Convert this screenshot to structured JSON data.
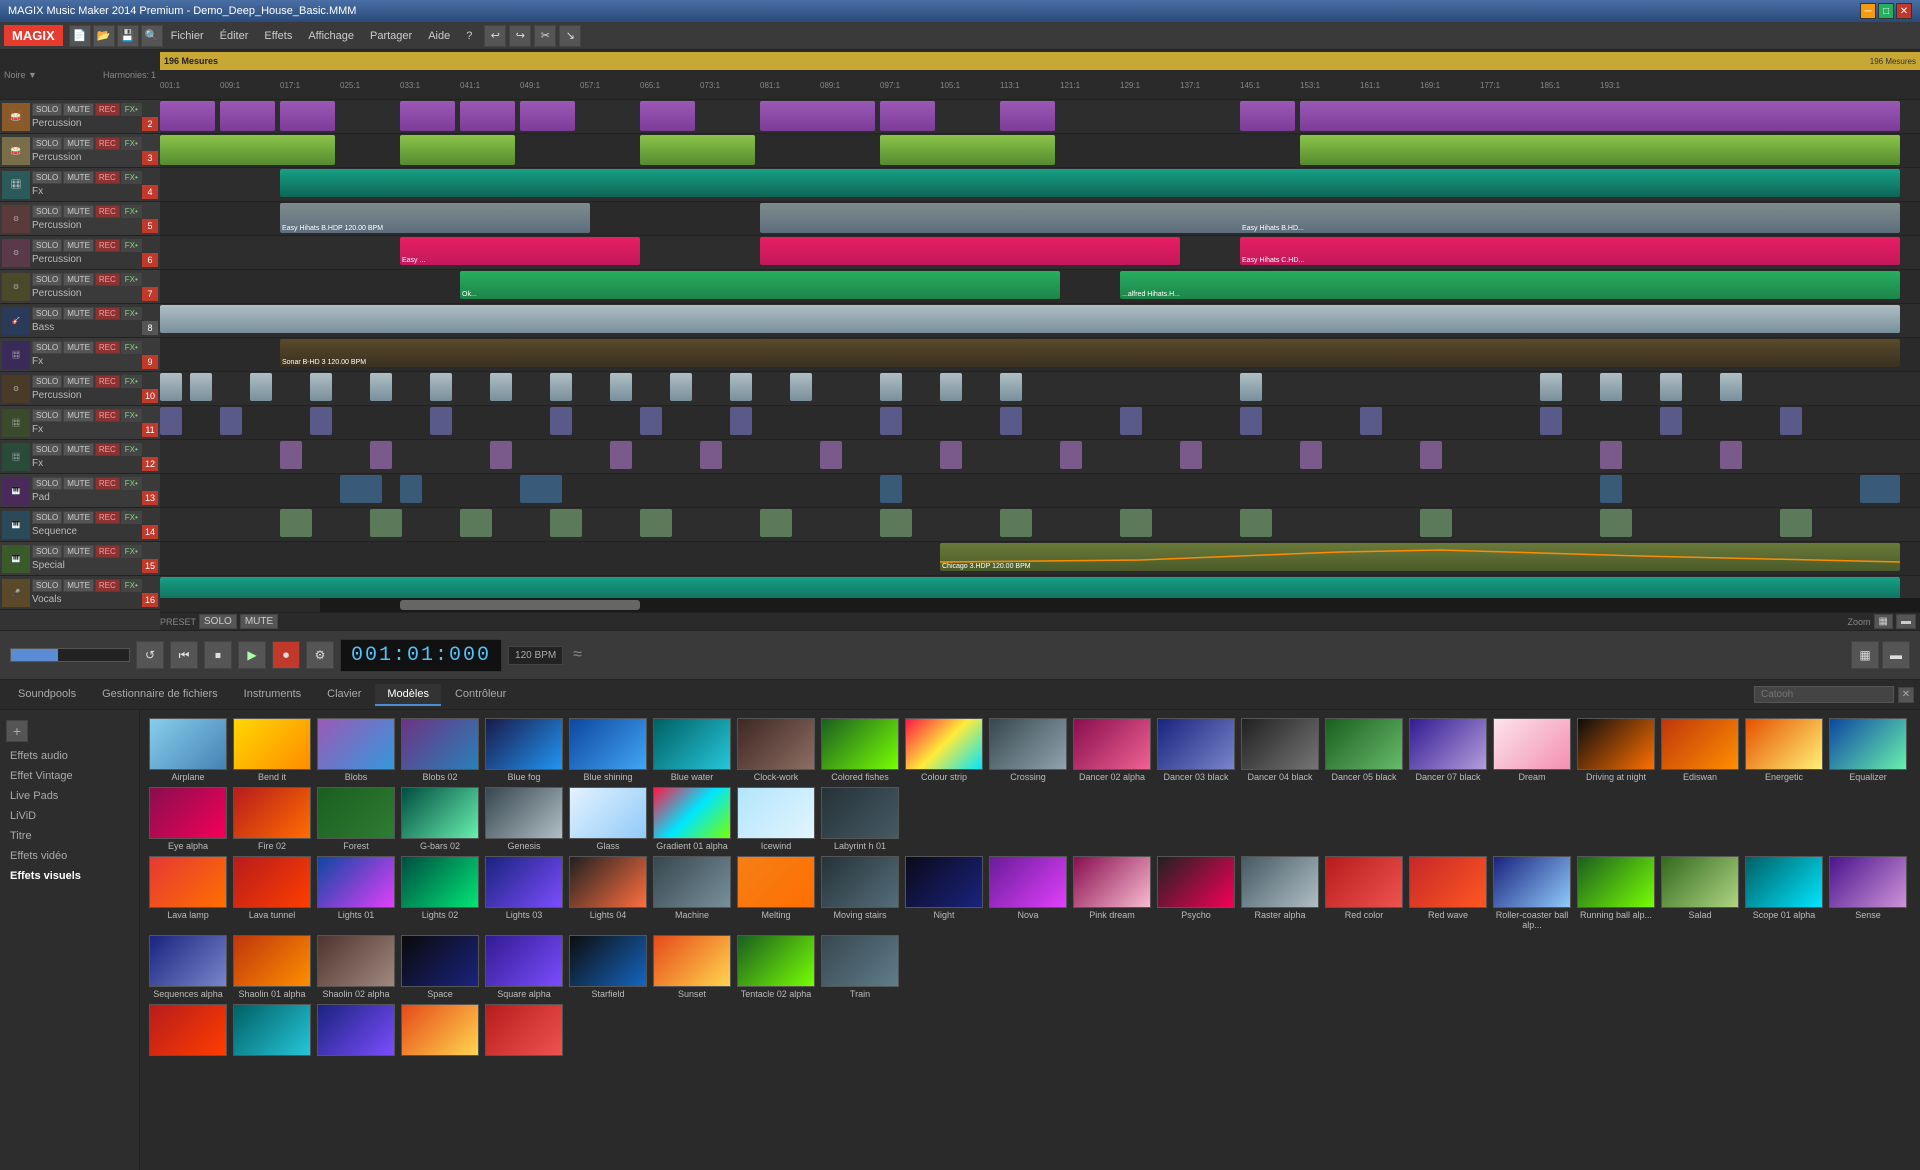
{
  "titlebar": {
    "title": "MAGIX Music Maker 2014 Premium - Demo_Deep_House_Basic.MMM",
    "min": "─",
    "max": "□",
    "close": "✕"
  },
  "menubar": {
    "items": [
      "Fichier",
      "Éditer",
      "Effets",
      "Affichage",
      "Partager",
      "Aide",
      "?"
    ]
  },
  "transport": {
    "time": "001:01:000",
    "bpm": "120 BPM",
    "loop_btn": "↺",
    "rewind_btn": "⏮",
    "stop_btn": "⏹",
    "play_btn": "▶",
    "record_btn": "⏺",
    "settings_btn": "⚙"
  },
  "tracks": [
    {
      "number": "2",
      "name": "Percussion",
      "type": "Percussion",
      "num_color": "red"
    },
    {
      "number": "3",
      "name": "Percussion",
      "type": "Percussion",
      "num_color": "red"
    },
    {
      "number": "4",
      "name": "Fx",
      "type": "Fx",
      "num_color": "red"
    },
    {
      "number": "5",
      "name": "Percussion",
      "type": "Percussion",
      "num_color": "red"
    },
    {
      "number": "6",
      "name": "Percussion",
      "type": "Percussion",
      "num_color": "red"
    },
    {
      "number": "7",
      "name": "Percussion",
      "type": "Percussion",
      "num_color": "red"
    },
    {
      "number": "8",
      "name": "Bass",
      "type": "Bass",
      "num_color": "gray"
    },
    {
      "number": "9",
      "name": "Fx",
      "type": "Fx",
      "num_color": "red"
    },
    {
      "number": "10",
      "name": "Percussion",
      "type": "Percussion",
      "num_color": "red"
    },
    {
      "number": "11",
      "name": "Fx",
      "type": "Fx",
      "num_color": "red"
    },
    {
      "number": "12",
      "name": "Fx",
      "type": "Fx",
      "num_color": "red"
    },
    {
      "number": "13",
      "name": "Pad",
      "type": "Pad",
      "num_color": "red"
    },
    {
      "number": "14",
      "name": "Sequence",
      "type": "Sequence",
      "num_color": "red"
    },
    {
      "number": "15",
      "name": "Special",
      "type": "Special",
      "num_color": "red"
    },
    {
      "number": "16",
      "name": "Vocals",
      "type": "Vocals",
      "num_color": "red"
    }
  ],
  "ruler": {
    "total_label": "196 Mesures",
    "markers": [
      "001:1",
      "009:1",
      "017:1",
      "025:1",
      "033:1",
      "041:1",
      "049:1",
      "057:1",
      "065:1",
      "073:1",
      "081:1",
      "089:1",
      "097:1",
      "105:1",
      "113:1",
      "121:1",
      "129:1",
      "137:1",
      "145:1",
      "153:1",
      "161:1",
      "169:1",
      "177:1",
      "185:1",
      "193:1"
    ]
  },
  "bottom_panel": {
    "tabs": [
      {
        "label": "Soundpools",
        "active": false
      },
      {
        "label": "Gestionnaire de fichiers",
        "active": false
      },
      {
        "label": "Instruments",
        "active": false
      },
      {
        "label": "Clavier",
        "active": false
      },
      {
        "label": "Modèles",
        "active": true
      },
      {
        "label": "Contrôleur",
        "active": false
      }
    ],
    "search_placeholder": "Catooh",
    "sidebar_items": [
      {
        "label": "Effets audio",
        "active": false
      },
      {
        "label": "Effet Vintage",
        "active": false
      },
      {
        "label": "Live Pads",
        "active": false
      },
      {
        "label": "LiViD",
        "active": false
      },
      {
        "label": "Titre",
        "active": false
      },
      {
        "label": "Effets vidéo",
        "active": false
      },
      {
        "label": "Effets visuels",
        "active": true
      }
    ],
    "media_row1": [
      {
        "label": "Airplane",
        "thumb": "thumb-airplane"
      },
      {
        "label": "Bend it",
        "thumb": "thumb-bend"
      },
      {
        "label": "Blobs",
        "thumb": "thumb-blobs"
      },
      {
        "label": "Blobs 02",
        "thumb": "thumb-blobs2"
      },
      {
        "label": "Blue fog",
        "thumb": "thumb-bluefog"
      },
      {
        "label": "Blue shining",
        "thumb": "thumb-blueshining"
      },
      {
        "label": "Blue water",
        "thumb": "thumb-bluewater"
      },
      {
        "label": "Clock-work",
        "thumb": "thumb-clockwork"
      },
      {
        "label": "Colored fishes",
        "thumb": "thumb-coloredfishes"
      },
      {
        "label": "Colour strip",
        "thumb": "thumb-colourstrip"
      },
      {
        "label": "Crossing",
        "thumb": "thumb-crossing"
      },
      {
        "label": "Dancer 02 alpha",
        "thumb": "thumb-dancer02"
      },
      {
        "label": "Dancer 03 black",
        "thumb": "thumb-dancer03"
      },
      {
        "label": "Dancer 04 black",
        "thumb": "thumb-dancer04"
      },
      {
        "label": "Dancer 05 black",
        "thumb": "thumb-dancer05"
      },
      {
        "label": "Dancer 07 black",
        "thumb": "thumb-dancer07"
      },
      {
        "label": "Dream",
        "thumb": "thumb-dream"
      },
      {
        "label": "Driving at night",
        "thumb": "thumb-drivingnight"
      },
      {
        "label": "Ediswan",
        "thumb": "thumb-ediswan"
      },
      {
        "label": "Energetic",
        "thumb": "thumb-energetic"
      },
      {
        "label": "Equalizer",
        "thumb": "thumb-equalizer"
      },
      {
        "label": "Eye alpha",
        "thumb": "thumb-eye"
      },
      {
        "label": "Fire 02",
        "thumb": "thumb-fire"
      },
      {
        "label": "Forest",
        "thumb": "thumb-forest"
      },
      {
        "label": "G-bars 02",
        "thumb": "thumb-gbars"
      },
      {
        "label": "Genesis",
        "thumb": "thumb-genesis"
      },
      {
        "label": "Glass",
        "thumb": "thumb-glass"
      },
      {
        "label": "Gradient 01 alpha",
        "thumb": "thumb-gradient"
      },
      {
        "label": "Icewind",
        "thumb": "thumb-icewind"
      },
      {
        "label": "Labyrint h 01",
        "thumb": "thumb-labyrinthe"
      }
    ],
    "media_row2": [
      {
        "label": "Lava lamp",
        "thumb": "thumb-lavalamp"
      },
      {
        "label": "Lava tunnel",
        "thumb": "thumb-lavatunnel"
      },
      {
        "label": "Lights 01",
        "thumb": "thumb-lights01"
      },
      {
        "label": "Lights 02",
        "thumb": "thumb-lights02"
      },
      {
        "label": "Lights 03",
        "thumb": "thumb-lights03"
      },
      {
        "label": "Lights 04",
        "thumb": "thumb-lights04"
      },
      {
        "label": "Machine",
        "thumb": "thumb-machine"
      },
      {
        "label": "Melting",
        "thumb": "thumb-melting"
      },
      {
        "label": "Moving stairs",
        "thumb": "thumb-movingstairs"
      },
      {
        "label": "Night",
        "thumb": "thumb-night"
      },
      {
        "label": "Nova",
        "thumb": "thumb-nova"
      },
      {
        "label": "Pink dream",
        "thumb": "thumb-pinkdream"
      },
      {
        "label": "Psycho",
        "thumb": "thumb-psycho"
      },
      {
        "label": "Raster alpha",
        "thumb": "thumb-rasteralpha"
      },
      {
        "label": "Red color",
        "thumb": "thumb-redcolor"
      },
      {
        "label": "Red wave",
        "thumb": "thumb-redwave"
      },
      {
        "label": "Roller-coaster ball alp...",
        "thumb": "thumb-rollercoaster"
      },
      {
        "label": "Running ball alp...",
        "thumb": "thumb-running"
      },
      {
        "label": "Salad",
        "thumb": "thumb-salad"
      },
      {
        "label": "Scope 01 alpha",
        "thumb": "thumb-scope"
      },
      {
        "label": "Sense",
        "thumb": "thumb-sense"
      },
      {
        "label": "Sequences alpha",
        "thumb": "thumb-sequences"
      },
      {
        "label": "Shaolin 01 alpha",
        "thumb": "thumb-shaolin01"
      },
      {
        "label": "Shaolin 02 alpha",
        "thumb": "thumb-shaolin02"
      },
      {
        "label": "Space",
        "thumb": "thumb-space"
      },
      {
        "label": "Square alpha",
        "thumb": "thumb-square"
      },
      {
        "label": "Starfield",
        "thumb": "thumb-starfield"
      },
      {
        "label": "Sunset",
        "thumb": "thumb-sunset"
      },
      {
        "label": "Tentacle 02 alpha",
        "thumb": "thumb-tentacle"
      },
      {
        "label": "Train",
        "thumb": "thumb-train"
      }
    ],
    "media_row3": [
      {
        "label": "",
        "thumb": "thumb-lavatunnel"
      },
      {
        "label": "",
        "thumb": "thumb-bluewater"
      },
      {
        "label": "",
        "thumb": "thumb-lights03"
      },
      {
        "label": "",
        "thumb": "thumb-sunset"
      },
      {
        "label": "",
        "thumb": "thumb-redcolor"
      }
    ]
  }
}
